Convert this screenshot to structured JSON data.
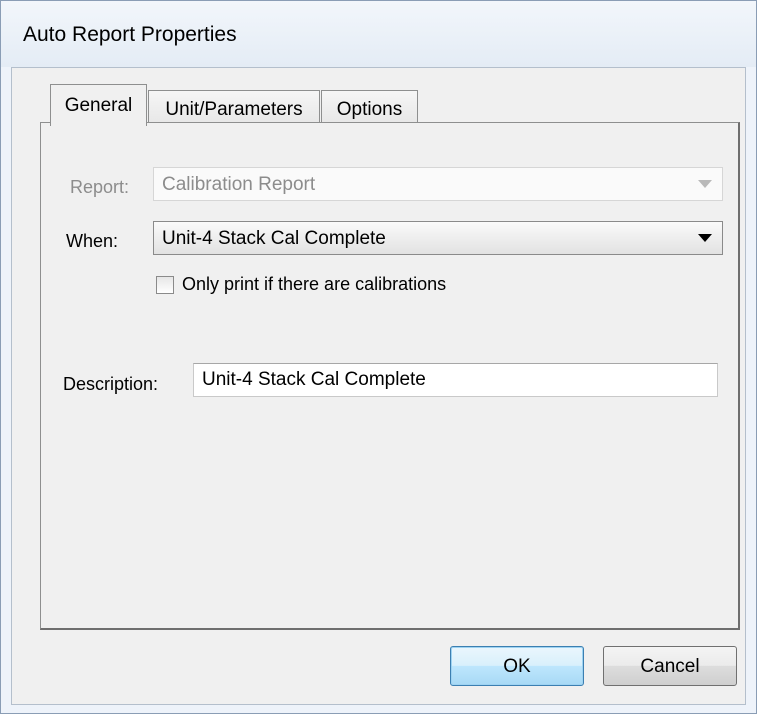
{
  "window": {
    "title": "Auto Report Properties"
  },
  "tabs": [
    {
      "label": "General",
      "active": true
    },
    {
      "label": "Unit/Parameters",
      "active": false
    },
    {
      "label": "Options",
      "active": false
    }
  ],
  "general": {
    "report_label": "Report:",
    "report_value": "Calibration Report",
    "when_label": "When:",
    "when_value": "Unit-4 Stack Cal Complete",
    "only_print_label": "Only print if there are calibrations",
    "only_print_checked": false,
    "description_label": "Description:",
    "description_value": "Unit-4 Stack Cal Complete"
  },
  "buttons": {
    "ok": "OK",
    "cancel": "Cancel"
  },
  "icons": {
    "dropdown": "chevron-down-icon"
  }
}
